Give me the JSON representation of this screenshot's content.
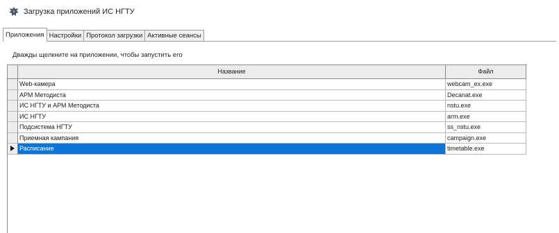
{
  "window": {
    "title": "Загрузка приложений ИС НГТУ",
    "icon": "app-emblem-icon"
  },
  "tabs": [
    {
      "label": "Приложения",
      "active": true
    },
    {
      "label": "Настройки",
      "active": false
    },
    {
      "label": "Протокол загрузки",
      "active": false
    },
    {
      "label": "Активные сеансы",
      "active": false
    }
  ],
  "panel": {
    "hint": "Дважды щелкните на приложении, чтобы запустить его"
  },
  "grid": {
    "columns": {
      "name": "Название",
      "file": "Файл"
    },
    "rows": [
      {
        "name": "Web-камера",
        "file": "webcam_ex.exe",
        "selected": false
      },
      {
        "name": "АРМ Методиста",
        "file": "Decanat.exe",
        "selected": false
      },
      {
        "name": "ИС НГТУ и АРМ Методиста",
        "file": "nstu.exe",
        "selected": false
      },
      {
        "name": "ИС НГТУ",
        "file": "arm.exe",
        "selected": false
      },
      {
        "name": "Подсистема НГТУ",
        "file": "ss_nstu.exe",
        "selected": false
      },
      {
        "name": "Приемная кампания",
        "file": "campaign.exe",
        "selected": false
      },
      {
        "name": "Расписание",
        "file": "timetable.exe",
        "selected": true
      }
    ],
    "colors": {
      "selection": "#0a74d8",
      "header_bg": "#ececec"
    }
  }
}
